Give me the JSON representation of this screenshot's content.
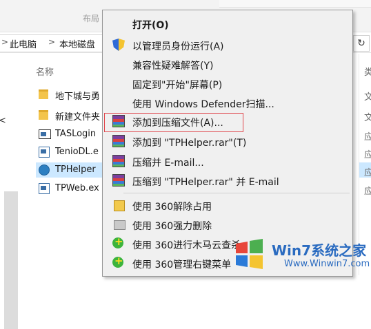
{
  "ribbon": {
    "label": "布局"
  },
  "address": {
    "crumbs": [
      "此电脑",
      "本地磁盘"
    ],
    "separator": ">",
    "refresh_icon": "↻"
  },
  "file_list": {
    "column_name": "名称",
    "nav_arrow": "<",
    "files": [
      {
        "name": "地下城与勇",
        "icon": "folder-icon",
        "right": "文"
      },
      {
        "name": "新建文件夹",
        "icon": "folder-icon",
        "right": "文"
      },
      {
        "name": "TASLogin",
        "icon": "window-exe-icon",
        "right": "应"
      },
      {
        "name": "TenioDL.e",
        "icon": "exe-icon",
        "right": "应"
      },
      {
        "name": "TPHelper",
        "icon": "tp-app-icon",
        "right": "应",
        "selected": true
      },
      {
        "name": "TPWeb.ex",
        "icon": "exe-icon",
        "right": "应"
      }
    ],
    "column_right": "类"
  },
  "context_menu": {
    "items": [
      {
        "label": "打开(O)",
        "bold": true,
        "icon": ""
      },
      {
        "label": "以管理员身份运行(A)",
        "icon": "uac-shield-icon"
      },
      {
        "label": "兼容性疑难解答(Y)",
        "icon": ""
      },
      {
        "label": "固定到\"开始\"屏幕(P)",
        "icon": ""
      },
      {
        "label": "使用 Windows Defender扫描...",
        "icon": ""
      },
      {
        "label": "添加到压缩文件(A)...",
        "icon": "winrar-icon",
        "highlighted": true
      },
      {
        "label": "添加到 \"TPHelper.rar\"(T)",
        "icon": "winrar-icon"
      },
      {
        "label": "压缩并 E-mail...",
        "icon": "winrar-icon"
      },
      {
        "label": "压缩到 \"TPHelper.rar\" 并 E-mail",
        "icon": "winrar-icon"
      },
      {
        "label": "使用 360解除占用",
        "icon": "360-unlock-icon"
      },
      {
        "label": "使用 360强力删除",
        "icon": "360-shred-icon"
      },
      {
        "label": "使用 360进行木马云查杀",
        "icon": "360-scan-icon"
      },
      {
        "label": "使用 360管理右键菜单",
        "icon": "360-menu-icon"
      }
    ]
  },
  "watermark": {
    "brand": "Win7系统之家",
    "url": "Www.Winwin7.com"
  },
  "colors": {
    "menu_bg": "#f0f0f0",
    "selection": "#cce8ff",
    "highlight_border": "#e0444a"
  }
}
